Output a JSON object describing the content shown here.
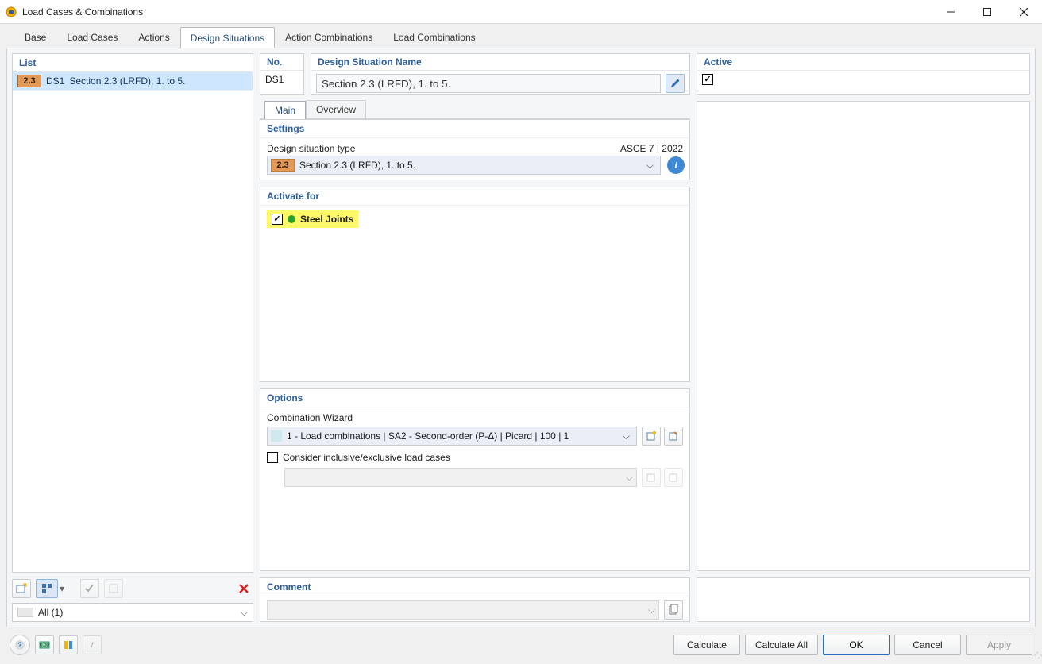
{
  "window": {
    "title": "Load Cases & Combinations"
  },
  "tabs": [
    "Base",
    "Load Cases",
    "Actions",
    "Design Situations",
    "Action Combinations",
    "Load Combinations"
  ],
  "active_tab_index": 3,
  "list": {
    "header": "List",
    "items": [
      {
        "badge": "2.3",
        "id": "DS1",
        "text": "Section 2.3 (LRFD), 1. to 5."
      }
    ],
    "filter_text": "All (1)"
  },
  "no_box": {
    "header": "No.",
    "value": "DS1"
  },
  "name_box": {
    "header": "Design Situation Name",
    "value": "Section 2.3 (LRFD), 1. to 5."
  },
  "active_box": {
    "header": "Active",
    "checked": true
  },
  "subtabs": [
    "Main",
    "Overview"
  ],
  "active_subtab_index": 0,
  "settings": {
    "header": "Settings",
    "type_label": "Design situation type",
    "standard": "ASCE 7 | 2022",
    "type_badge": "2.3",
    "type_text": "Section 2.3 (LRFD), 1. to 5."
  },
  "activate": {
    "header": "Activate for",
    "items": [
      {
        "label": "Steel Joints",
        "checked": true
      }
    ]
  },
  "options": {
    "header": "Options",
    "wizard_label": "Combination Wizard",
    "wizard_value": "1 - Load combinations | SA2 - Second-order (P-Δ) | Picard | 100 | 1",
    "incl_excl_label": "Consider inclusive/exclusive load cases",
    "incl_excl_checked": false
  },
  "comment": {
    "header": "Comment",
    "value": ""
  },
  "footer": {
    "calculate": "Calculate",
    "calculate_all": "Calculate All",
    "ok": "OK",
    "cancel": "Cancel",
    "apply": "Apply"
  }
}
